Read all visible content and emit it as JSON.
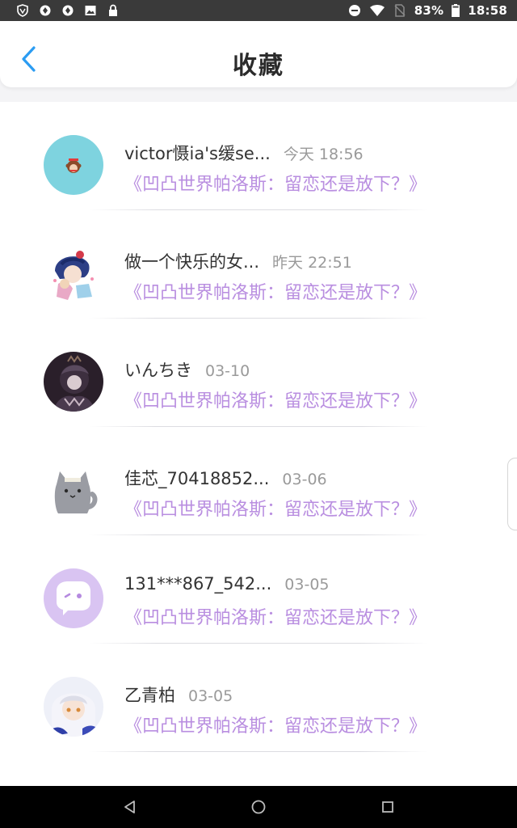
{
  "status_bar": {
    "battery": "83%",
    "time": "18:58",
    "left_icons": [
      "shield-icon",
      "sync-icon",
      "sync-icon",
      "image-icon",
      "lock-icon"
    ],
    "right_icons": [
      "dnd-icon",
      "wifi-icon",
      "no-sim-icon",
      "battery-icon"
    ]
  },
  "header": {
    "title": "收藏",
    "back_icon": "chevron-left-icon"
  },
  "favorites": [
    {
      "name": "victor慑ia's缓se...",
      "time": "今天 18:56",
      "article": "《凹凸世界帕洛斯：留恋还是放下？》",
      "avatar": "monkey"
    },
    {
      "name": "做一个快乐的女...",
      "time": "昨天 22:51",
      "article": "《凹凸世界帕洛斯：留恋还是放下？》",
      "avatar": "anime-girl"
    },
    {
      "name": "いんちき",
      "time": "03-10",
      "article": "《凹凸世界帕洛斯：留恋还是放下？》",
      "avatar": "dark-character"
    },
    {
      "name": "佳芯_70418852...",
      "time": "03-06",
      "article": "《凹凸世界帕洛斯：留恋还是放下？》",
      "avatar": "gray-cat"
    },
    {
      "name": "131***867_542...",
      "time": "03-05",
      "article": "《凹凸世界帕洛斯：留恋还是放下？》",
      "avatar": "default-chat"
    },
    {
      "name": "乙青柏",
      "time": "03-05",
      "article": "《凹凸世界帕洛斯：留恋还是放下？》",
      "avatar": "white-hair-girl"
    }
  ],
  "colors": {
    "accent": "#2b9cf2",
    "article_link": "#b98ee0"
  },
  "nav_bar": [
    "back-icon",
    "home-icon",
    "recents-icon"
  ]
}
